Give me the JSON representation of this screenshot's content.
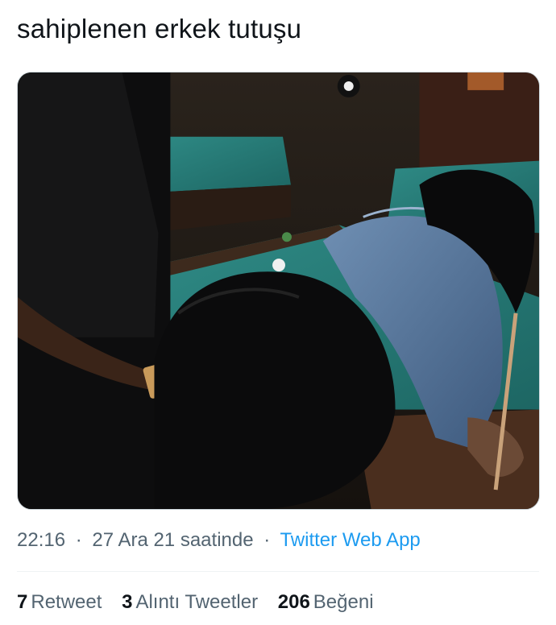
{
  "tweet": {
    "text": "sahiplenen erkek tutuşu",
    "media_alt": "photo"
  },
  "meta": {
    "time": "22:16",
    "date_label": "27 Ara 21 saatinde",
    "separator": "·",
    "source": "Twitter Web App"
  },
  "stats": {
    "retweets": {
      "count": "7",
      "label": "Retweet"
    },
    "quotes": {
      "count": "3",
      "label": "Alıntı Tweetler"
    },
    "likes": {
      "count": "206",
      "label": "Beğeni"
    }
  },
  "colors": {
    "text": "#0f1419",
    "secondary": "#536471",
    "link": "#1d9bf0",
    "divider": "#eff3f4"
  }
}
